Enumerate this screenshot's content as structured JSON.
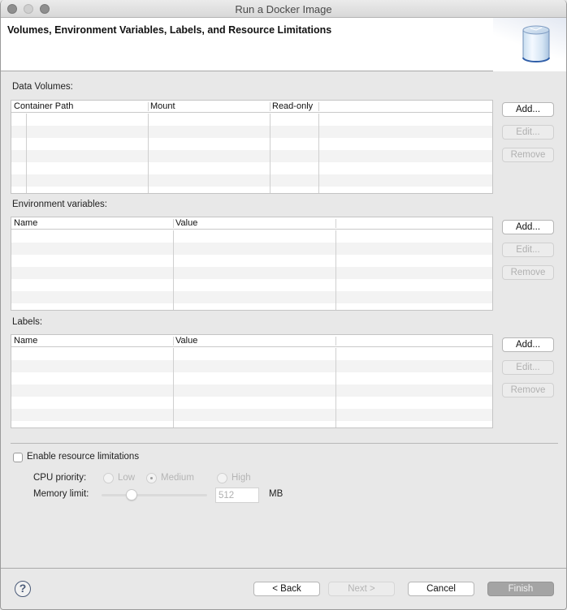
{
  "window": {
    "title": "Run a Docker Image"
  },
  "banner": {
    "title": "Volumes, Environment Variables, Labels, and Resource Limitations",
    "icon": "database-cylinder-icon"
  },
  "data_volumes": {
    "label": "Data Volumes:",
    "columns": [
      "Container Path",
      "Mount",
      "Read-only"
    ],
    "rows": [],
    "buttons": {
      "add": "Add...",
      "edit": "Edit...",
      "remove": "Remove"
    }
  },
  "environment_variables": {
    "label": "Environment variables:",
    "columns": [
      "Name",
      "Value"
    ],
    "rows": [],
    "buttons": {
      "add": "Add...",
      "edit": "Edit...",
      "remove": "Remove"
    }
  },
  "labels": {
    "label": "Labels:",
    "columns": [
      "Name",
      "Value"
    ],
    "rows": [],
    "buttons": {
      "add": "Add...",
      "edit": "Edit...",
      "remove": "Remove"
    }
  },
  "resources": {
    "enable_label": "Enable resource limitations",
    "enabled": false,
    "cpu_label": "CPU priority:",
    "cpu_options": [
      "Low",
      "Medium",
      "High"
    ],
    "cpu_selected": "Medium",
    "memory_label": "Memory limit:",
    "memory_value": "512",
    "memory_unit": "MB"
  },
  "footer": {
    "help_icon": "help-icon",
    "back": "< Back",
    "next": "Next >",
    "cancel": "Cancel",
    "finish": "Finish"
  }
}
